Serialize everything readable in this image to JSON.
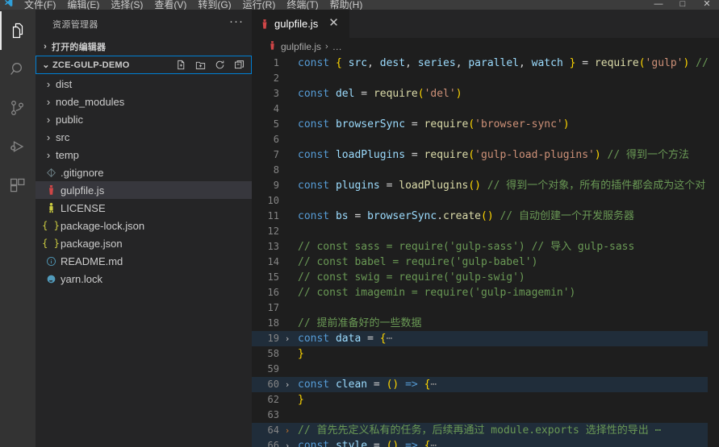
{
  "window": {
    "menu_items": [
      "文件(F)",
      "编辑(E)",
      "选择(S)",
      "查看(V)",
      "转到(G)",
      "运行(R)",
      "终端(T)",
      "帮助(H)"
    ],
    "controls": [
      "—",
      "□",
      "✕"
    ]
  },
  "activitybar": {
    "items": [
      {
        "name": "explorer",
        "icon": "files-icon",
        "active": true
      },
      {
        "name": "search",
        "icon": "search-icon",
        "active": false
      },
      {
        "name": "source-control",
        "icon": "source-control-icon",
        "active": false
      },
      {
        "name": "run-debug",
        "icon": "run-and-debug-icon",
        "active": false
      },
      {
        "name": "extensions",
        "icon": "extensions-icon",
        "active": false
      }
    ]
  },
  "sidebar": {
    "title": "资源管理器",
    "more_actions": "···",
    "open_editors": {
      "label": "打开的编辑器",
      "expanded": false,
      "chevron": "›"
    },
    "project": {
      "label": "ZCE-GULP-DEMO",
      "expanded": true,
      "chevron": "⌄",
      "actions": [
        "new-file-icon",
        "new-folder-icon",
        "refresh-icon",
        "collapse-all-icon"
      ]
    },
    "files": [
      {
        "label": "dist",
        "type": "folder",
        "chevron": "›",
        "icon": "",
        "selected": false
      },
      {
        "label": "node_modules",
        "type": "folder",
        "chevron": "›",
        "icon": "",
        "selected": false
      },
      {
        "label": "public",
        "type": "folder",
        "chevron": "›",
        "icon": "",
        "selected": false
      },
      {
        "label": "src",
        "type": "folder",
        "chevron": "›",
        "icon": "",
        "selected": false
      },
      {
        "label": "temp",
        "type": "folder",
        "chevron": "›",
        "icon": "",
        "selected": false
      },
      {
        "label": ".gitignore",
        "type": "file",
        "chevron": "",
        "icon": "git-icon",
        "glyph": "◈",
        "color": "#6d8086",
        "selected": false
      },
      {
        "label": "gulpfile.js",
        "type": "file",
        "chevron": "",
        "icon": "gulp-icon",
        "glyph": "❥",
        "color": "#cf4647",
        "selected": true
      },
      {
        "label": "LICENSE",
        "type": "file",
        "chevron": "",
        "icon": "license-icon",
        "glyph": "⚐",
        "color": "#cbcb41",
        "selected": false
      },
      {
        "label": "package-lock.json",
        "type": "file",
        "chevron": "",
        "icon": "json-icon",
        "glyph": "{ }",
        "color": "#cbcb41",
        "selected": false
      },
      {
        "label": "package.json",
        "type": "file",
        "chevron": "",
        "icon": "json-icon",
        "glyph": "{ }",
        "color": "#cbcb41",
        "selected": false
      },
      {
        "label": "README.md",
        "type": "file",
        "chevron": "",
        "icon": "markdown-icon",
        "glyph": "ⓘ",
        "color": "#519aba",
        "selected": false
      },
      {
        "label": "yarn.lock",
        "type": "file",
        "chevron": "",
        "icon": "yarn-icon",
        "glyph": "♠",
        "color": "#519aba",
        "selected": false
      }
    ]
  },
  "editor": {
    "tab": {
      "label": "gulpfile.js",
      "close": "✕",
      "icon": "gulp-icon",
      "glyph": "❥"
    },
    "breadcrumb": {
      "file": "gulpfile.js",
      "separator": "›",
      "more": "…",
      "glyph": "❥"
    },
    "lines": [
      {
        "num": "1",
        "fold": "",
        "folded": false,
        "tokens": [
          {
            "t": "const",
            "c": "kw"
          },
          {
            "t": " ",
            "c": "pun"
          },
          {
            "t": "{",
            "c": "br1"
          },
          {
            "t": " ",
            "c": "pun"
          },
          {
            "t": "src",
            "c": "var"
          },
          {
            "t": ", ",
            "c": "pun"
          },
          {
            "t": "dest",
            "c": "var"
          },
          {
            "t": ", ",
            "c": "pun"
          },
          {
            "t": "series",
            "c": "var"
          },
          {
            "t": ", ",
            "c": "pun"
          },
          {
            "t": "parallel",
            "c": "var"
          },
          {
            "t": ", ",
            "c": "pun"
          },
          {
            "t": "watch",
            "c": "var"
          },
          {
            "t": " ",
            "c": "pun"
          },
          {
            "t": "}",
            "c": "br1"
          },
          {
            "t": " = ",
            "c": "op"
          },
          {
            "t": "require",
            "c": "fn"
          },
          {
            "t": "(",
            "c": "br1"
          },
          {
            "t": "'gulp'",
            "c": "str"
          },
          {
            "t": ")",
            "c": "br1"
          },
          {
            "t": " // 导",
            "c": "com"
          }
        ]
      },
      {
        "num": "2",
        "fold": "",
        "folded": false,
        "tokens": []
      },
      {
        "num": "3",
        "fold": "",
        "folded": false,
        "tokens": [
          {
            "t": "const",
            "c": "kw"
          },
          {
            "t": " ",
            "c": "pun"
          },
          {
            "t": "del",
            "c": "var"
          },
          {
            "t": " = ",
            "c": "op"
          },
          {
            "t": "require",
            "c": "fn"
          },
          {
            "t": "(",
            "c": "br1"
          },
          {
            "t": "'del'",
            "c": "str"
          },
          {
            "t": ")",
            "c": "br1"
          }
        ]
      },
      {
        "num": "4",
        "fold": "",
        "folded": false,
        "tokens": []
      },
      {
        "num": "5",
        "fold": "",
        "folded": false,
        "tokens": [
          {
            "t": "const",
            "c": "kw"
          },
          {
            "t": " ",
            "c": "pun"
          },
          {
            "t": "browserSync",
            "c": "var"
          },
          {
            "t": " = ",
            "c": "op"
          },
          {
            "t": "require",
            "c": "fn"
          },
          {
            "t": "(",
            "c": "br1"
          },
          {
            "t": "'browser-sync'",
            "c": "str"
          },
          {
            "t": ")",
            "c": "br1"
          }
        ]
      },
      {
        "num": "6",
        "fold": "",
        "folded": false,
        "tokens": []
      },
      {
        "num": "7",
        "fold": "",
        "folded": false,
        "tokens": [
          {
            "t": "const",
            "c": "kw"
          },
          {
            "t": " ",
            "c": "pun"
          },
          {
            "t": "loadPlugins",
            "c": "var"
          },
          {
            "t": " = ",
            "c": "op"
          },
          {
            "t": "require",
            "c": "fn"
          },
          {
            "t": "(",
            "c": "br1"
          },
          {
            "t": "'gulp-load-plugins'",
            "c": "str"
          },
          {
            "t": ")",
            "c": "br1"
          },
          {
            "t": " // 得到一个方法",
            "c": "com"
          }
        ]
      },
      {
        "num": "8",
        "fold": "",
        "folded": false,
        "tokens": []
      },
      {
        "num": "9",
        "fold": "",
        "folded": false,
        "tokens": [
          {
            "t": "const",
            "c": "kw"
          },
          {
            "t": " ",
            "c": "pun"
          },
          {
            "t": "plugins",
            "c": "var"
          },
          {
            "t": " = ",
            "c": "op"
          },
          {
            "t": "loadPlugins",
            "c": "fn"
          },
          {
            "t": "()",
            "c": "br1"
          },
          {
            "t": " // 得到一个对象，所有的插件都会成为这个对",
            "c": "com"
          }
        ]
      },
      {
        "num": "10",
        "fold": "",
        "folded": false,
        "tokens": []
      },
      {
        "num": "11",
        "fold": "",
        "folded": false,
        "tokens": [
          {
            "t": "const",
            "c": "kw"
          },
          {
            "t": " ",
            "c": "pun"
          },
          {
            "t": "bs",
            "c": "var"
          },
          {
            "t": " = ",
            "c": "op"
          },
          {
            "t": "browserSync",
            "c": "var"
          },
          {
            "t": ".",
            "c": "pun"
          },
          {
            "t": "create",
            "c": "fn"
          },
          {
            "t": "()",
            "c": "br1"
          },
          {
            "t": " // 自动创建一个开发服务器",
            "c": "com"
          }
        ]
      },
      {
        "num": "12",
        "fold": "",
        "folded": false,
        "tokens": []
      },
      {
        "num": "13",
        "fold": "",
        "folded": false,
        "tokens": [
          {
            "t": "// const sass = require('gulp-sass') // 导入 gulp-sass",
            "c": "com"
          }
        ]
      },
      {
        "num": "14",
        "fold": "",
        "folded": false,
        "tokens": [
          {
            "t": "// const babel = require('gulp-babel')",
            "c": "com"
          }
        ]
      },
      {
        "num": "15",
        "fold": "",
        "folded": false,
        "tokens": [
          {
            "t": "// const swig = require('gulp-swig')",
            "c": "com"
          }
        ]
      },
      {
        "num": "16",
        "fold": "",
        "folded": false,
        "tokens": [
          {
            "t": "// const imagemin = require('gulp-imagemin')",
            "c": "com"
          }
        ]
      },
      {
        "num": "17",
        "fold": "",
        "folded": false,
        "tokens": []
      },
      {
        "num": "18",
        "fold": "",
        "folded": false,
        "tokens": [
          {
            "t": "// 提前准备好的一些数据",
            "c": "com"
          }
        ]
      },
      {
        "num": "19",
        "fold": "›",
        "folded": true,
        "tokens": [
          {
            "t": "const",
            "c": "kw"
          },
          {
            "t": " ",
            "c": "pun"
          },
          {
            "t": "data",
            "c": "var"
          },
          {
            "t": " = ",
            "c": "op"
          },
          {
            "t": "{",
            "c": "br1"
          },
          {
            "t": "⋯",
            "c": "ell"
          }
        ]
      },
      {
        "num": "58",
        "fold": "",
        "folded": false,
        "tokens": [
          {
            "t": "}",
            "c": "br1"
          }
        ]
      },
      {
        "num": "59",
        "fold": "",
        "folded": false,
        "tokens": []
      },
      {
        "num": "60",
        "fold": "›",
        "folded": true,
        "tokens": [
          {
            "t": "const",
            "c": "kw"
          },
          {
            "t": " ",
            "c": "pun"
          },
          {
            "t": "clean",
            "c": "var"
          },
          {
            "t": " = ",
            "c": "op"
          },
          {
            "t": "()",
            "c": "br1"
          },
          {
            "t": " => ",
            "c": "kw"
          },
          {
            "t": "{",
            "c": "br1"
          },
          {
            "t": "⋯",
            "c": "ell"
          }
        ]
      },
      {
        "num": "62",
        "fold": "",
        "folded": false,
        "tokens": [
          {
            "t": "}",
            "c": "br1"
          }
        ]
      },
      {
        "num": "63",
        "fold": "",
        "folded": false,
        "tokens": []
      },
      {
        "num": "64",
        "fold": "›",
        "folded": true,
        "foldOrange": true,
        "tokens": [
          {
            "t": "// 首先先定义私有的任务，后续再通过 module.exports 选择性的导出 ⋯",
            "c": "com"
          }
        ]
      },
      {
        "num": "66",
        "fold": "›",
        "folded": true,
        "tokens": [
          {
            "t": "const",
            "c": "kw"
          },
          {
            "t": " ",
            "c": "pun"
          },
          {
            "t": "style",
            "c": "var"
          },
          {
            "t": " = ",
            "c": "op"
          },
          {
            "t": "()",
            "c": "br1"
          },
          {
            "t": " => ",
            "c": "kw"
          },
          {
            "t": "{",
            "c": "br1"
          },
          {
            "t": "⋯",
            "c": "ell"
          }
        ]
      }
    ]
  }
}
